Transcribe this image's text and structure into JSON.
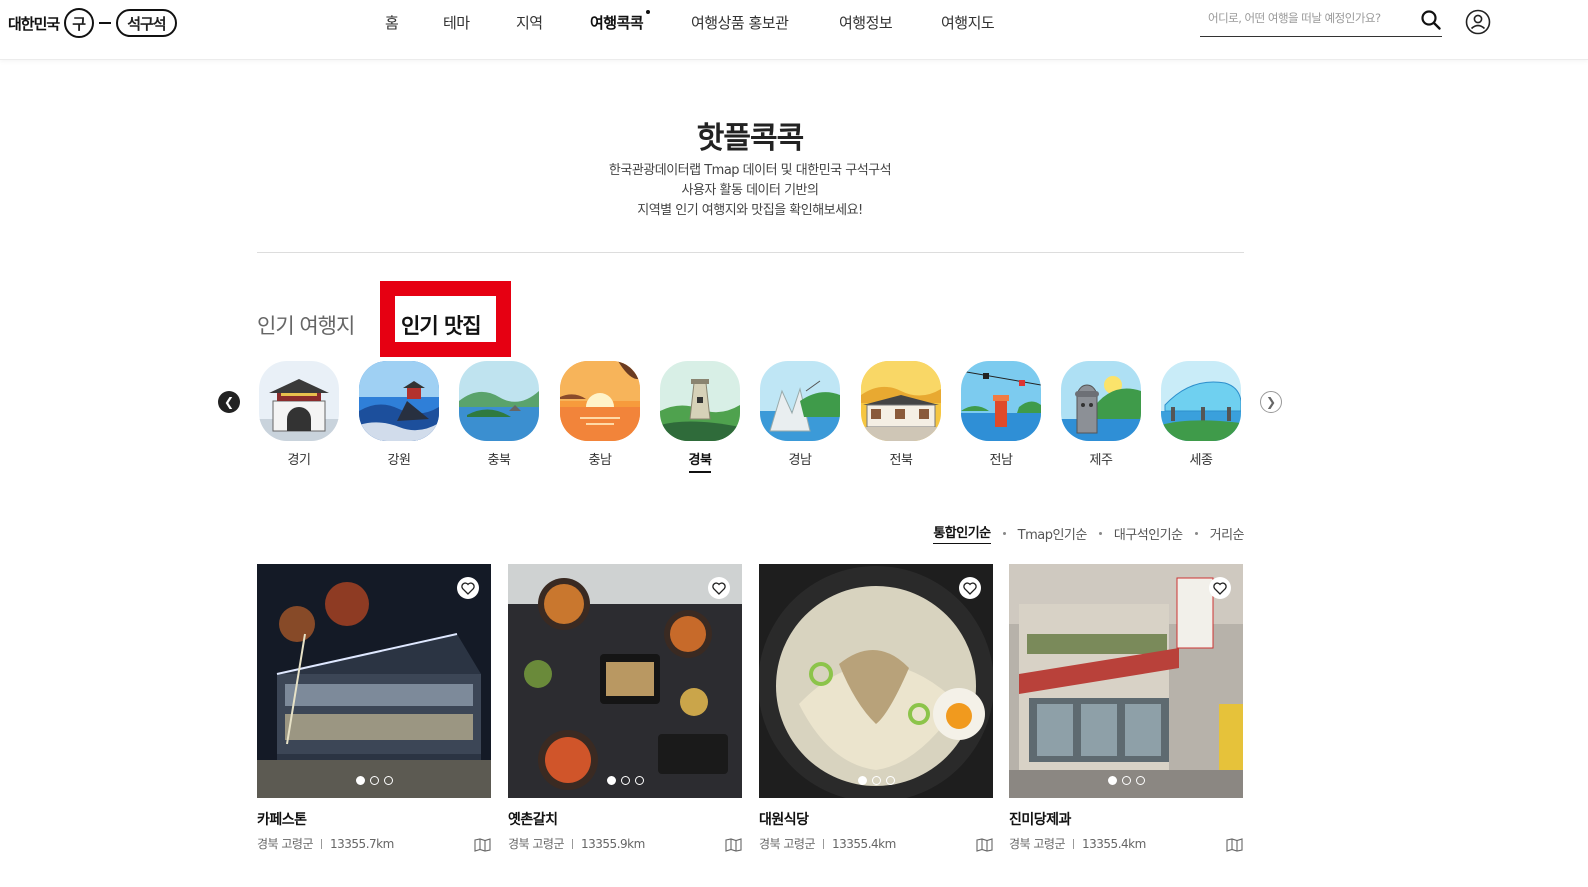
{
  "header": {
    "logo": {
      "left_text": "대한민국",
      "circle_text": "구",
      "pill_text": "석구석"
    },
    "nav": [
      {
        "label": "홈",
        "active": false
      },
      {
        "label": "테마",
        "active": false
      },
      {
        "label": "지역",
        "active": false
      },
      {
        "label": "여행콕콕",
        "active": true
      },
      {
        "label": "여행상품 홍보관",
        "active": false
      },
      {
        "label": "여행정보",
        "active": false
      },
      {
        "label": "여행지도",
        "active": false
      }
    ],
    "search_placeholder": "어디로, 어떤 여행을 떠날 예정인가요?"
  },
  "main": {
    "title": "핫플콕콕",
    "description": [
      "한국관광데이터랩 Tmap 데이터 및 대한민국 구석구석",
      "사용자 활동 데이터 기반의",
      "지역별 인기 여행지와 맛집을 확인해보세요!"
    ],
    "tabs": {
      "places": "인기 여행지",
      "food": "인기 맛집"
    },
    "regions": [
      "경기",
      "강원",
      "충북",
      "충남",
      "경북",
      "경남",
      "전북",
      "전남",
      "제주",
      "세종"
    ],
    "active_region": "경북",
    "sort": [
      "통합인기순",
      "Tmap인기순",
      "대구석인기순",
      "거리순"
    ],
    "active_sort": "통합인기순",
    "cards": [
      {
        "name": "카페스톤",
        "location": "경북 고령군",
        "distance": "13355.7km"
      },
      {
        "name": "옛촌갈치",
        "location": "경북 고령군",
        "distance": "13355.9km"
      },
      {
        "name": "대원식당",
        "location": "경북 고령군",
        "distance": "13355.4km"
      },
      {
        "name": "진미당제과",
        "location": "경북 고령군",
        "distance": "13355.4km"
      }
    ]
  },
  "colors": {
    "highlight": "#e60012",
    "text": "#222222"
  }
}
